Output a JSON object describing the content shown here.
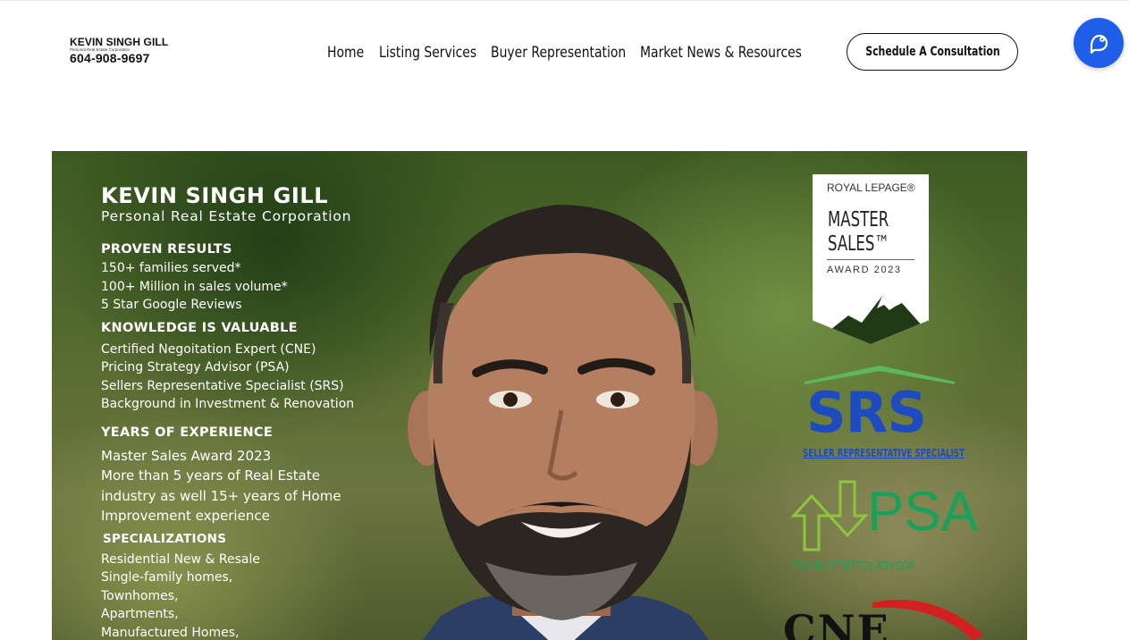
{
  "header": {
    "logo": {
      "name": "KEVIN SINGH GILL",
      "subtitle": "Personal Real Estate Corporation",
      "phone": "604-908-9697"
    },
    "nav": [
      {
        "label": "Home"
      },
      {
        "label": "Listing Services"
      },
      {
        "label": "Buyer Representation"
      },
      {
        "label": "Market News & Resources"
      }
    ],
    "cta_label": "Schedule A Consultation",
    "chat_icon": "chat-support-icon"
  },
  "hero": {
    "name": "KEVIN SINGH GILL",
    "corp": "Personal Real Estate Corporation",
    "sections": [
      {
        "title": "PROVEN RESULTS",
        "lines": [
          "150+ families served*",
          "100+ Million in sales volume*",
          "5 Star Google Reviews"
        ]
      },
      {
        "title": "KNOWLEDGE IS VALUABLE",
        "lines": [
          "Certified Negoitation Expert (CNE)",
          "Pricing Strategy Advisor (PSA)",
          "Sellers Representative Specialist (SRS)",
          "Background in Investment & Renovation"
        ]
      },
      {
        "title": "YEARS OF EXPERIENCE",
        "lines": [
          "Master Sales Award 2023",
          "More than 5 years of Real Estate",
          "industry as well 15+ years of Home",
          "Improvement experience"
        ]
      },
      {
        "title": "SPECIALIZATIONS",
        "lines": [
          "Residential New & Resale",
          "Single-family homes,",
          "Townhomes,",
          "Apartments,",
          "Manufactured Homes,"
        ]
      }
    ],
    "badges": {
      "royal_lepage": "ROYAL LEPAGE®",
      "master": "MASTER",
      "sales": "SALES™",
      "award": "AWARD 2023",
      "srs": "SRS",
      "srs_caption": "SELLER REPRESENTATIVE SPECIALIST",
      "psa": "PSA",
      "psa_caption": "PRICING STRATEGY ADVISOR",
      "cne": "CNE"
    }
  },
  "colors": {
    "brand_blue": "#1f5ee8",
    "srs_blue": "#1e4bbf",
    "psa_green": "#19a05a",
    "srs_green": "#5cb85c"
  }
}
